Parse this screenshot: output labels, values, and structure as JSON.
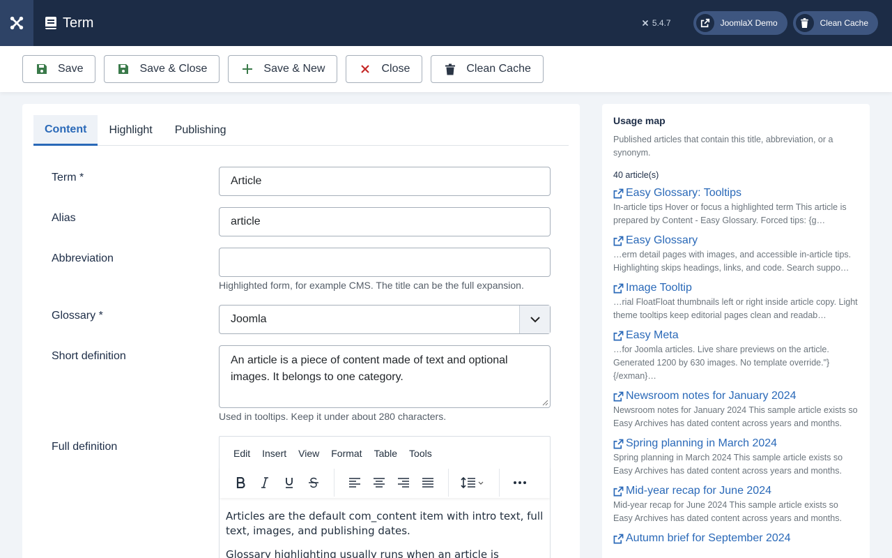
{
  "header": {
    "page_title": "Term",
    "version": "5.4.7",
    "site_button": "JoomlaX Demo",
    "clean_cache_button": "Clean Cache"
  },
  "toolbar": {
    "save": "Save",
    "save_close": "Save & Close",
    "save_new": "Save & New",
    "close": "Close",
    "clean_cache": "Clean Cache"
  },
  "tabs": [
    "Content",
    "Highlight",
    "Publishing"
  ],
  "form": {
    "term_label": "Term *",
    "term_value": "Article",
    "alias_label": "Alias",
    "alias_value": "article",
    "abbreviation_label": "Abbreviation",
    "abbreviation_value": "",
    "abbreviation_help": "Highlighted form, for example CMS. The title can be the full expansion.",
    "glossary_label": "Glossary *",
    "glossary_value": "Joomla",
    "short_definition_label": "Short definition",
    "short_definition_value": "An article is a piece of content made of text and optional images. It belongs to one category.",
    "short_definition_help": "Used in tooltips. Keep it under about 280 characters.",
    "full_definition_label": "Full definition"
  },
  "editor": {
    "menu": [
      "Edit",
      "Insert",
      "View",
      "Format",
      "Table",
      "Tools"
    ],
    "paragraphs": [
      "Articles are the default com_content item with intro text, full text, images, and publishing dates.",
      "Glossary highlighting usually runs when an article is prepared for"
    ]
  },
  "usage_map": {
    "title": "Usage map",
    "description": "Published articles that contain this title, abbreviation, or a synonym.",
    "count": "40 article(s)",
    "articles": [
      {
        "title": "Easy Glossary: Tooltips",
        "snippet": "In-article tips Hover or focus a highlighted term This article is prepared by Content - Easy Glossary. Forced tips: {g…"
      },
      {
        "title": "Easy Glossary",
        "snippet": "…erm detail pages with images, and accessible in-article tips. Highlighting skips headings, links, and code. Search suppo…"
      },
      {
        "title": "Image Tooltip",
        "snippet": "…rial FloatFloat thumbnails left or right inside article copy. Light theme tooltips keep editorial pages clean and readab…"
      },
      {
        "title": "Easy Meta",
        "snippet": "…for Joomla articles. Live share previews on the article. Generated 1200 by 630 images. No template override.\"} {/exman}…"
      },
      {
        "title": "Newsroom notes for January 2024",
        "snippet": "Newsroom notes for January 2024 This sample article exists so Easy Archives has dated content across years and months."
      },
      {
        "title": "Spring planning in March 2024",
        "snippet": "Spring planning in March 2024 This sample article exists so Easy Archives has dated content across years and months."
      },
      {
        "title": "Mid-year recap for June 2024",
        "snippet": "Mid-year recap for June 2024 This sample article exists so Easy Archives has dated content across years and months."
      },
      {
        "title": "Autumn brief for September 2024",
        "snippet": ""
      }
    ]
  },
  "colors": {
    "header_bg": "#1c2c46",
    "accent": "#2a69b8",
    "save_green": "#3a7a4a",
    "close_red": "#c52827"
  }
}
